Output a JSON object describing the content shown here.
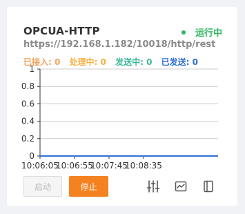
{
  "card": {
    "title": "OPCUA-HTTP",
    "status": {
      "label": "运行中",
      "color": "#2db55d"
    },
    "url": "https://192.168.1.182/10018/http/rest",
    "stats": [
      {
        "label": "已接入",
        "value": 0,
        "color": "#f5a25d"
      },
      {
        "label": "处理中",
        "value": 0,
        "color": "#f5b041"
      },
      {
        "label": "发送中",
        "value": 0,
        "color": "#3bb89a"
      },
      {
        "label": "已发送",
        "value": 0,
        "color": "#2f6fd6"
      }
    ],
    "buttons": {
      "start_label": "启动",
      "stop_label": "停止"
    },
    "icons": [
      "settings-sliders-icon",
      "chart-icon",
      "panel-icon"
    ]
  },
  "chart_data": {
    "type": "line",
    "x": [
      "10:06:05",
      "10:06:55",
      "10:07:45",
      "10:08:35"
    ],
    "ylim": [
      0,
      1
    ],
    "yticks": [
      "0",
      "0.2",
      "0.4",
      "0.6",
      "0.8",
      "1"
    ],
    "grid": true,
    "series": [
      {
        "values": [
          0,
          0,
          0,
          0
        ],
        "color": "#2f6fd6"
      }
    ]
  }
}
